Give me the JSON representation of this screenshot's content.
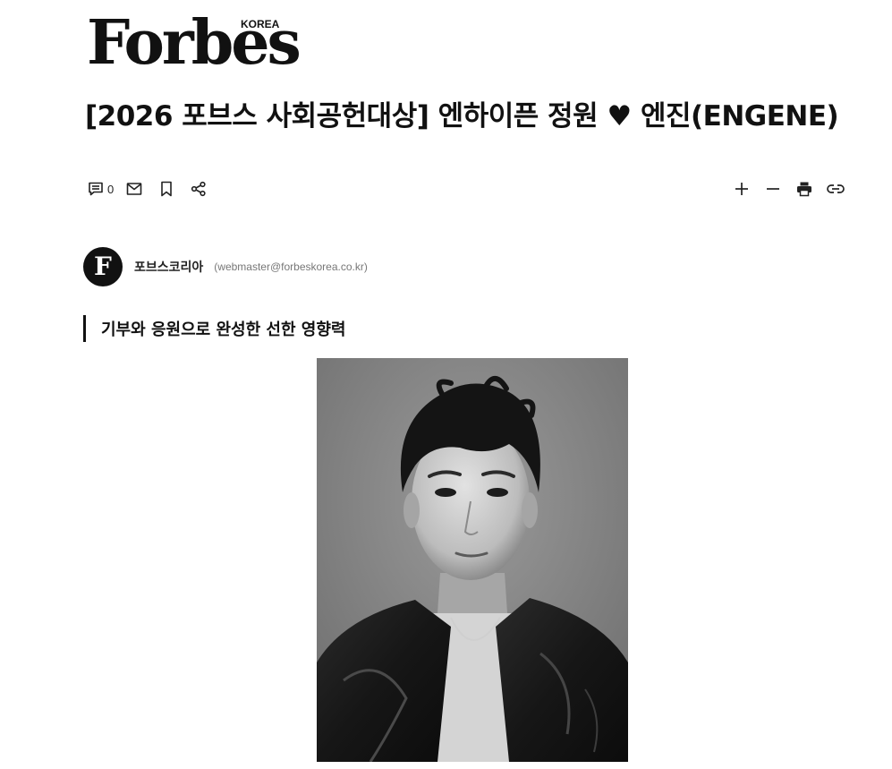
{
  "logo": {
    "wordmark": "Forbes",
    "edition": "KOREA"
  },
  "article": {
    "headline": "[2026 포브스 사회공헌대상] 엔하이픈 정원 ♥ 엔진(ENGENE)",
    "subtitle": "기부와 응원으로 완성한 선한 영향력"
  },
  "toolbar": {
    "comment_count": "0",
    "left_icons": [
      "comment-icon",
      "mail-icon",
      "bookmark-icon",
      "share-icon"
    ],
    "right_icons": [
      "plus-icon",
      "minus-icon",
      "print-icon",
      "link-icon"
    ]
  },
  "author": {
    "avatar_letter": "F",
    "name": "포브스코리아",
    "email": "(webmaster@forbeskorea.co.kr)"
  },
  "colors": {
    "text": "#111111",
    "muted": "#777777",
    "background": "#ffffff"
  }
}
